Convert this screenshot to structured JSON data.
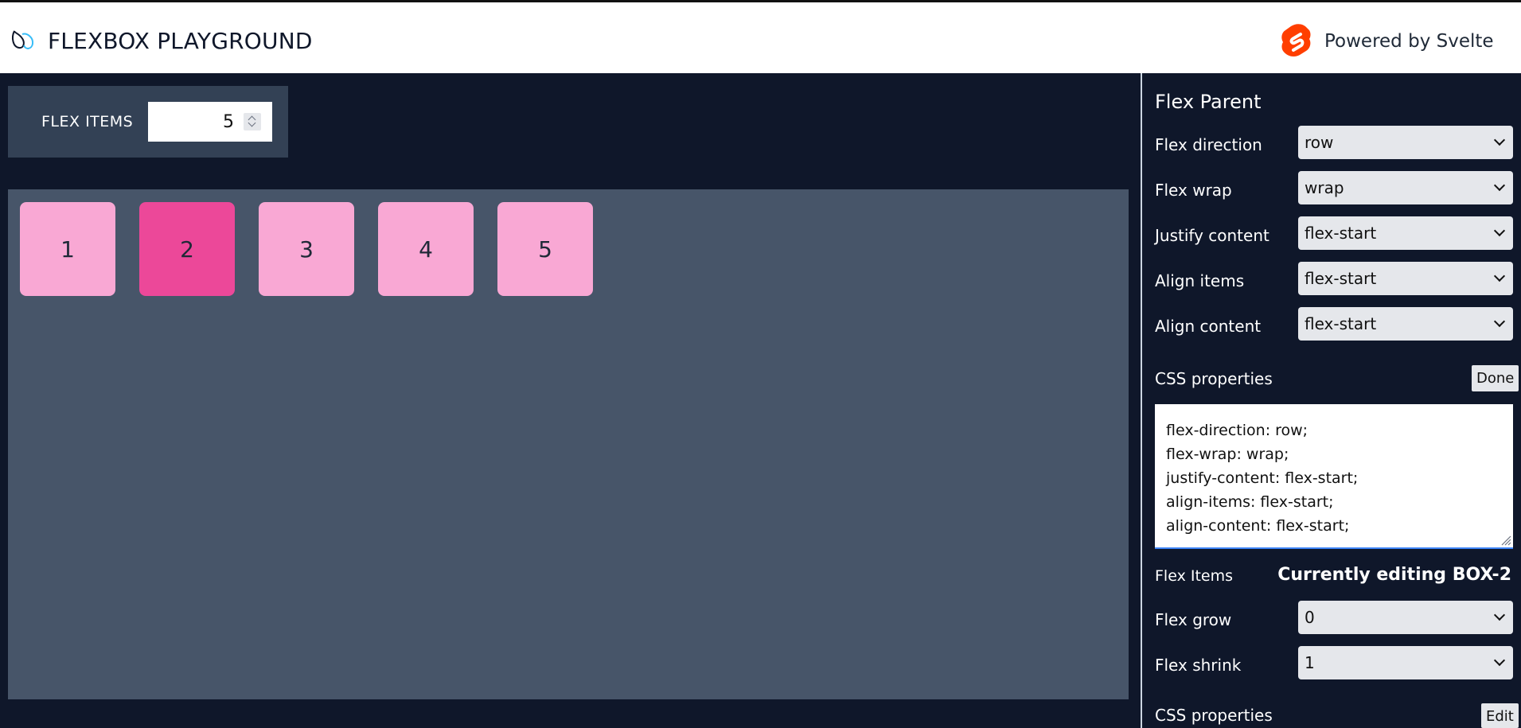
{
  "header": {
    "title": "FLEXBOX PLAYGROUND",
    "powered_by": "Powered by Svelte"
  },
  "controls": {
    "items_label": "FLEX ITEMS",
    "items_value": "5"
  },
  "boxes": [
    {
      "label": "1",
      "selected": false
    },
    {
      "label": "2",
      "selected": true
    },
    {
      "label": "3",
      "selected": false
    },
    {
      "label": "4",
      "selected": false
    },
    {
      "label": "5",
      "selected": false
    }
  ],
  "flex_parent": {
    "title": "Flex Parent",
    "fields": [
      {
        "label": "Flex direction",
        "value": "row"
      },
      {
        "label": "Flex wrap",
        "value": "wrap"
      },
      {
        "label": "Justify content",
        "value": "flex-start"
      },
      {
        "label": "Align items",
        "value": "flex-start"
      },
      {
        "label": "Align content",
        "value": "flex-start"
      }
    ],
    "css_label": "CSS properties",
    "done_label": "Done",
    "css_lines": [
      "flex-direction: row;",
      "flex-wrap: wrap;",
      "justify-content: flex-start;",
      "align-items: flex-start;",
      "align-content: flex-start;"
    ]
  },
  "flex_items": {
    "title": "Flex Items",
    "editing": "Currently editing BOX-2",
    "fields": [
      {
        "label": "Flex grow",
        "value": "0"
      },
      {
        "label": "Flex shrink",
        "value": "1"
      }
    ],
    "css_label": "CSS properties",
    "edit_label": "Edit"
  },
  "colors": {
    "background": "#0f172a",
    "container": "#475569",
    "box": "#f9a8d4",
    "box_selected": "#ec4899",
    "svelte": "#ff3e00"
  }
}
